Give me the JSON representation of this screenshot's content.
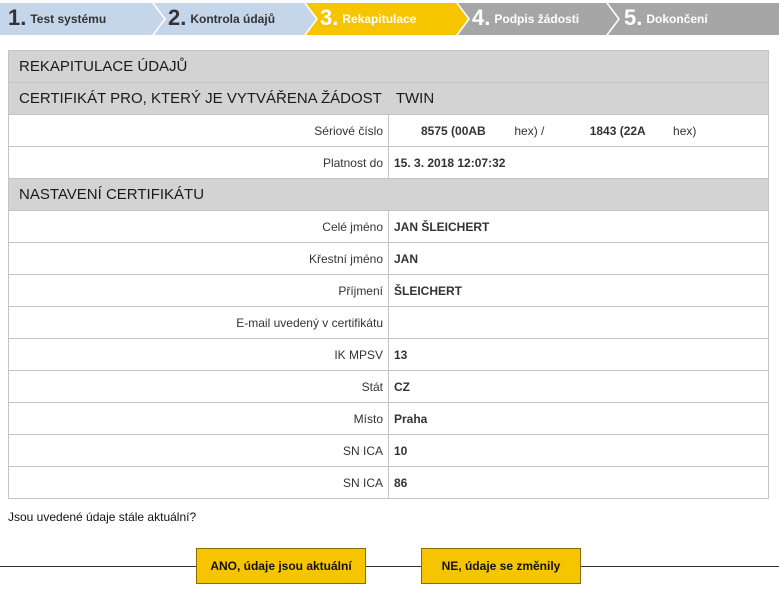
{
  "wizard": {
    "steps": [
      {
        "num": "1.",
        "label": "Test systému"
      },
      {
        "num": "2.",
        "label": "Kontrola údajů"
      },
      {
        "num": "3.",
        "label": "Rekapitulace"
      },
      {
        "num": "4.",
        "label": "Podpis žádosti"
      },
      {
        "num": "5.",
        "label": "Dokončení"
      }
    ],
    "colors": {
      "done": "#c5d6ea",
      "active": "#f7c400",
      "future": "#a6a6a6"
    }
  },
  "summary": {
    "title": "REKAPITULACE ÚDAJŮ",
    "certificate_header": "CERTIFIKÁT PRO, KTERÝ JE VYTVÁŘENA ŽÁDOST",
    "certificate_name": "TWIN",
    "serial": {
      "label": "Sériové číslo",
      "dec1": "8575 (00AB",
      "hex1": "hex) /",
      "dec2": "1843 (22A",
      "hex2": "hex)"
    },
    "validity": {
      "label": "Platnost do",
      "value": "15. 3. 2018 12:07:32"
    },
    "settings_header": "NASTAVENÍ CERTIFIKÁTU",
    "fields": [
      {
        "label": "Celé jméno",
        "value": "JAN ŠLEICHERT"
      },
      {
        "label": "Křestní jméno",
        "value": "JAN"
      },
      {
        "label": "Příjmení",
        "value": "ŠLEICHERT"
      },
      {
        "label": "E-mail uvedený v certifikátu",
        "value": ""
      },
      {
        "label": "IK MPSV",
        "value": "13"
      },
      {
        "label": "Stát",
        "value": "CZ"
      },
      {
        "label": "Místo",
        "value": "Praha"
      },
      {
        "label": "SN ICA",
        "value": "10"
      },
      {
        "label": "SN ICA",
        "value": "86"
      }
    ]
  },
  "question": "Jsou uvedené údaje stále aktuální?",
  "buttons": {
    "yes": "ANO, údaje jsou aktuální",
    "no": "NE, údaje se změnily"
  }
}
